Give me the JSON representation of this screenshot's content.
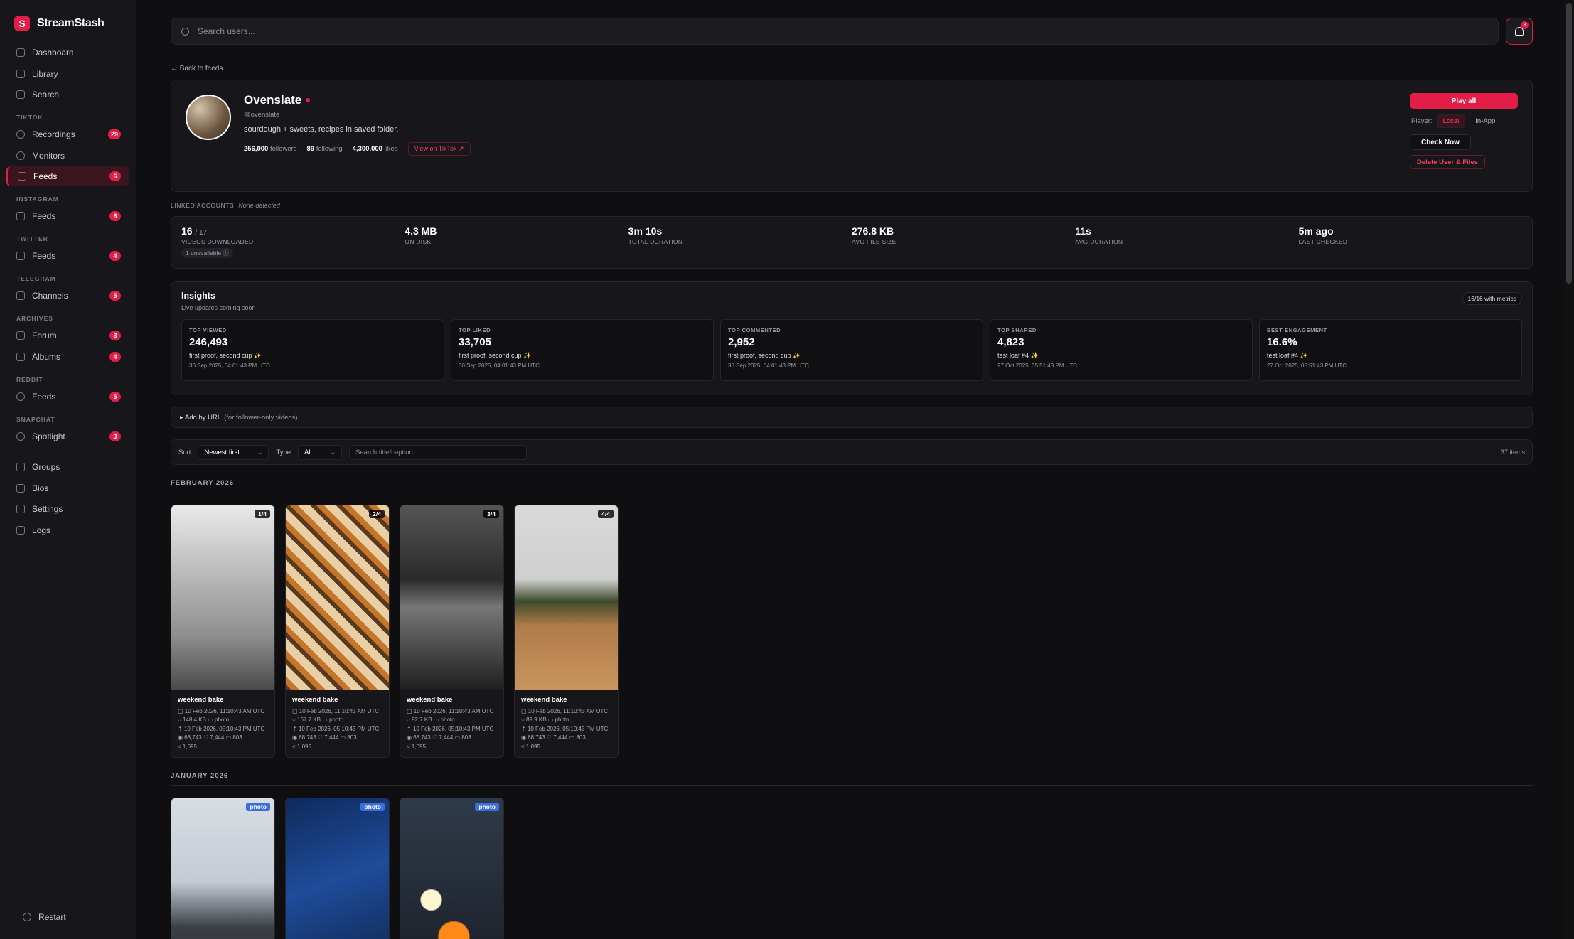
{
  "app": {
    "name": "StreamStash",
    "logo_letter": "S",
    "accent": "#e11d48"
  },
  "sidebar": {
    "top": [
      {
        "label": "Dashboard",
        "icon": "grid-icon"
      },
      {
        "label": "Library",
        "icon": "book-icon"
      },
      {
        "label": "Search",
        "icon": "search-icon"
      }
    ],
    "sections": [
      {
        "title": "TIKTOK",
        "items": [
          {
            "label": "Recordings",
            "icon": "record-icon",
            "badge": "29"
          },
          {
            "label": "Monitors",
            "icon": "eye-icon",
            "badge": ""
          },
          {
            "label": "Feeds",
            "icon": "download-icon",
            "badge": "6",
            "active": true
          }
        ]
      },
      {
        "title": "INSTAGRAM",
        "items": [
          {
            "label": "Feeds",
            "icon": "instagram-icon",
            "badge": "6"
          }
        ]
      },
      {
        "title": "TWITTER",
        "items": [
          {
            "label": "Feeds",
            "icon": "twitter-icon",
            "badge": "4"
          }
        ]
      },
      {
        "title": "TELEGRAM",
        "items": [
          {
            "label": "Channels",
            "icon": "send-icon",
            "badge": "5"
          }
        ]
      },
      {
        "title": "ARCHIVES",
        "items": [
          {
            "label": "Forum",
            "icon": "chat-icon",
            "badge": "3"
          },
          {
            "label": "Albums",
            "icon": "image-icon",
            "badge": "4"
          }
        ]
      },
      {
        "title": "REDDIT",
        "items": [
          {
            "label": "Feeds",
            "icon": "reddit-icon",
            "badge": "5"
          }
        ]
      },
      {
        "title": "SNAPCHAT",
        "items": [
          {
            "label": "Spotlight",
            "icon": "ghost-icon",
            "badge": "3"
          }
        ]
      }
    ],
    "bottom": [
      {
        "label": "Groups",
        "icon": "users-icon"
      },
      {
        "label": "Bios",
        "icon": "user-icon"
      },
      {
        "label": "Settings",
        "icon": "gear-icon"
      },
      {
        "label": "Logs",
        "icon": "file-icon"
      }
    ],
    "restart": "Restart"
  },
  "search": {
    "placeholder": "Search users..."
  },
  "notifications": {
    "count": "8"
  },
  "back": "← Back to feeds",
  "profile": {
    "name": "Ovenslate",
    "handle": "@ovenslate",
    "bio": "sourdough + sweets, recipes in saved folder.",
    "followers": "256,000",
    "followers_label": "followers",
    "following": "89",
    "following_label": "following",
    "likes": "4,300,000",
    "likes_label": "likes",
    "tiktok_link": "View on TikTok ↗",
    "play_all": "Play all",
    "player_label": "Player:",
    "player_local": "Local",
    "player_inapp": "In-App",
    "check_now": "Check Now",
    "delete": "Delete User & Files"
  },
  "linked": {
    "label": "LINKED ACCOUNTS",
    "value": "None detected"
  },
  "metrics": [
    {
      "value": "16",
      "sub": "/ 17",
      "label": "VIDEOS DOWNLOADED",
      "extra": "1 unavailable ⓘ"
    },
    {
      "value": "4.3 MB",
      "sub": "",
      "label": "ON DISK",
      "extra": ""
    },
    {
      "value": "3m 10s",
      "sub": "",
      "label": "TOTAL DURATION",
      "extra": ""
    },
    {
      "value": "276.8 KB",
      "sub": "",
      "label": "AVG FILE SIZE",
      "extra": ""
    },
    {
      "value": "11s",
      "sub": "",
      "label": "AVG DURATION",
      "extra": ""
    },
    {
      "value": "5m ago",
      "sub": "",
      "label": "LAST CHECKED",
      "extra": ""
    }
  ],
  "insights": {
    "title": "Insights",
    "subtitle": "Live updates coming soon",
    "pill": "16/16 with metrics",
    "cards": [
      {
        "key": "TOP VIEWED",
        "value": "246,493",
        "title": "first proof, second cup ✨",
        "date": "30 Sep 2025, 04:01:43 PM UTC"
      },
      {
        "key": "TOP LIKED",
        "value": "33,705",
        "title": "first proof, second cup ✨",
        "date": "30 Sep 2025, 04:01:43 PM UTC"
      },
      {
        "key": "TOP COMMENTED",
        "value": "2,952",
        "title": "first proof, second cup ✨",
        "date": "30 Sep 2025, 04:01:43 PM UTC"
      },
      {
        "key": "TOP SHARED",
        "value": "4,823",
        "title": "test loaf #4 ✨",
        "date": "27 Oct 2025, 05:51:43 PM UTC"
      },
      {
        "key": "BEST ENGAGEMENT",
        "value": "16.6%",
        "title": "test loaf #4 ✨",
        "date": "27 Oct 2025, 05:51:43 PM UTC"
      }
    ]
  },
  "add_url": {
    "label": "▸  Add by URL",
    "hint": "(for follower-only videos)"
  },
  "toolbar": {
    "sort_label": "Sort",
    "sort_value": "Newest first",
    "type_label": "Type",
    "type_value": "All",
    "search_placeholder": "Search title/caption...",
    "items": "37 items"
  },
  "groups": [
    {
      "month": "FEBRUARY 2026",
      "tiles": [
        {
          "tag": "1/4",
          "tag_type": "count",
          "title": "weekend bake",
          "created": "10 Feb 2026, 11:10:43 AM UTC",
          "size": "148.4 KB",
          "kind": "photo",
          "uploaded": "10 Feb 2026, 05:10:43 PM UTC",
          "views": "68,743",
          "likes": "7,444",
          "comments": "803",
          "shares": "1,095",
          "bg": "linear-gradient(180deg,#e9e9e9 0%,#bdbdbd 35%,#8f8f8f 70%,#4a4a4a 100%)"
        },
        {
          "tag": "2/4",
          "tag_type": "count",
          "title": "weekend bake",
          "created": "10 Feb 2026, 11:10:43 AM UTC",
          "size": "167.7 KB",
          "kind": "photo",
          "uploaded": "10 Feb 2026, 05:10:43 PM UTC",
          "views": "68,743",
          "likes": "7,444",
          "comments": "803",
          "shares": "1,095",
          "bg": "repeating-linear-gradient(45deg,#5a3a1e 0 6px,#c6762b 6px 14px,#e8cfa6 14px 26px)"
        },
        {
          "tag": "3/4",
          "tag_type": "count",
          "title": "weekend bake",
          "created": "10 Feb 2026, 11:10:43 AM UTC",
          "size": "92.7 KB",
          "kind": "photo",
          "uploaded": "10 Feb 2026, 05:10:43 PM UTC",
          "views": "68,743",
          "likes": "7,444",
          "comments": "803",
          "shares": "1,095",
          "bg": "linear-gradient(180deg,#555 0%,#2a2a2a 40%,#777 55%,#1e1e1e 100%)"
        },
        {
          "tag": "4/4",
          "tag_type": "count",
          "title": "weekend bake",
          "created": "10 Feb 2026, 11:10:43 AM UTC",
          "size": "89.9 KB",
          "kind": "photo",
          "uploaded": "10 Feb 2026, 05:10:43 PM UTC",
          "views": "68,743",
          "likes": "7,444",
          "comments": "803",
          "shares": "1,095",
          "bg": "linear-gradient(180deg,#d9d9d9 0%,#cfcfcf 40%,#3d4a2a 52%,#b07b4a 65%,#c9955e 100%)"
        }
      ]
    },
    {
      "month": "JANUARY 2026",
      "tiles": [
        {
          "tag": "photo",
          "tag_type": "type",
          "bg": "linear-gradient(180deg,#d8dde3 0%,#c5ccd4 45%,#3a3f45 70%,#2a2d31 100%)"
        },
        {
          "tag": "photo",
          "tag_type": "type",
          "bg": "linear-gradient(160deg,#0f2a5c 0%,#1e4c9a 45%,#0d2246 100%)"
        },
        {
          "tag": "photo",
          "tag_type": "type",
          "bg": "radial-gradient(circle at 30% 55%,#fff6d0 0 8%,transparent 9%),radial-gradient(circle at 52% 75%,#ff8a1a 0 10%,transparent 11%),linear-gradient(180deg,#2f3b4a,#1a1e26)"
        }
      ]
    }
  ]
}
